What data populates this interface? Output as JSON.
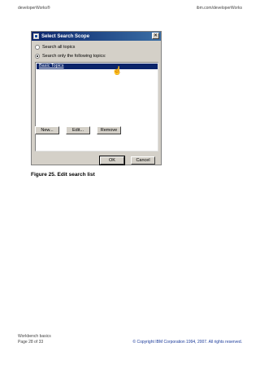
{
  "header": {
    "left": "developerWorks®",
    "right": "ibm.com/developerWorks"
  },
  "dialog": {
    "title": "Select Search Scope",
    "close_symbol": "✕",
    "radio_all": "Search all topics",
    "radio_only": "Search only the following topics:",
    "list_items": [
      "Basic Topics"
    ],
    "buttons": {
      "new": "New...",
      "edit": "Edit...",
      "remove": "Remove",
      "ok": "OK",
      "cancel": "Cancel"
    }
  },
  "caption": "Figure 25. Edit search list",
  "footer": {
    "title": "Workbench basics",
    "page": "Page 28 of 33",
    "copyright": "© Copyright IBM Corporation 1994, 2007. All rights reserved."
  },
  "icons": {
    "title_icon": "window-app-icon",
    "cursor": "hand-pointer-icon"
  }
}
